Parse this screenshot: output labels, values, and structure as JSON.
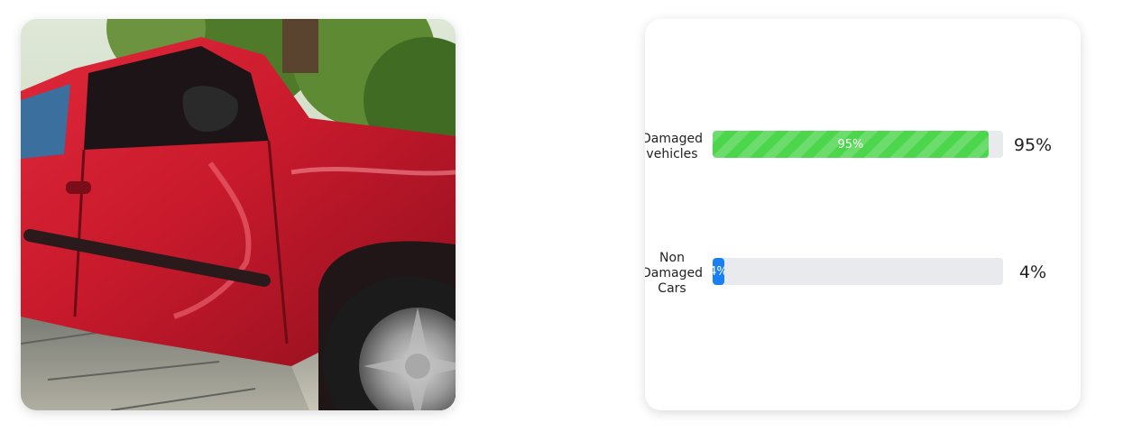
{
  "chart_data": {
    "type": "bar",
    "categories": [
      "Damaged\nvehicles",
      "Non\nDamaged\nCars"
    ],
    "values": [
      95,
      4
    ],
    "bar_labels": [
      "95%",
      "4%"
    ],
    "value_labels": [
      "95%",
      "4%"
    ],
    "colors": [
      "#4cd64c",
      "#1a7ff0"
    ],
    "track_color": "#e8eaed",
    "ylim": [
      0,
      100
    ]
  }
}
